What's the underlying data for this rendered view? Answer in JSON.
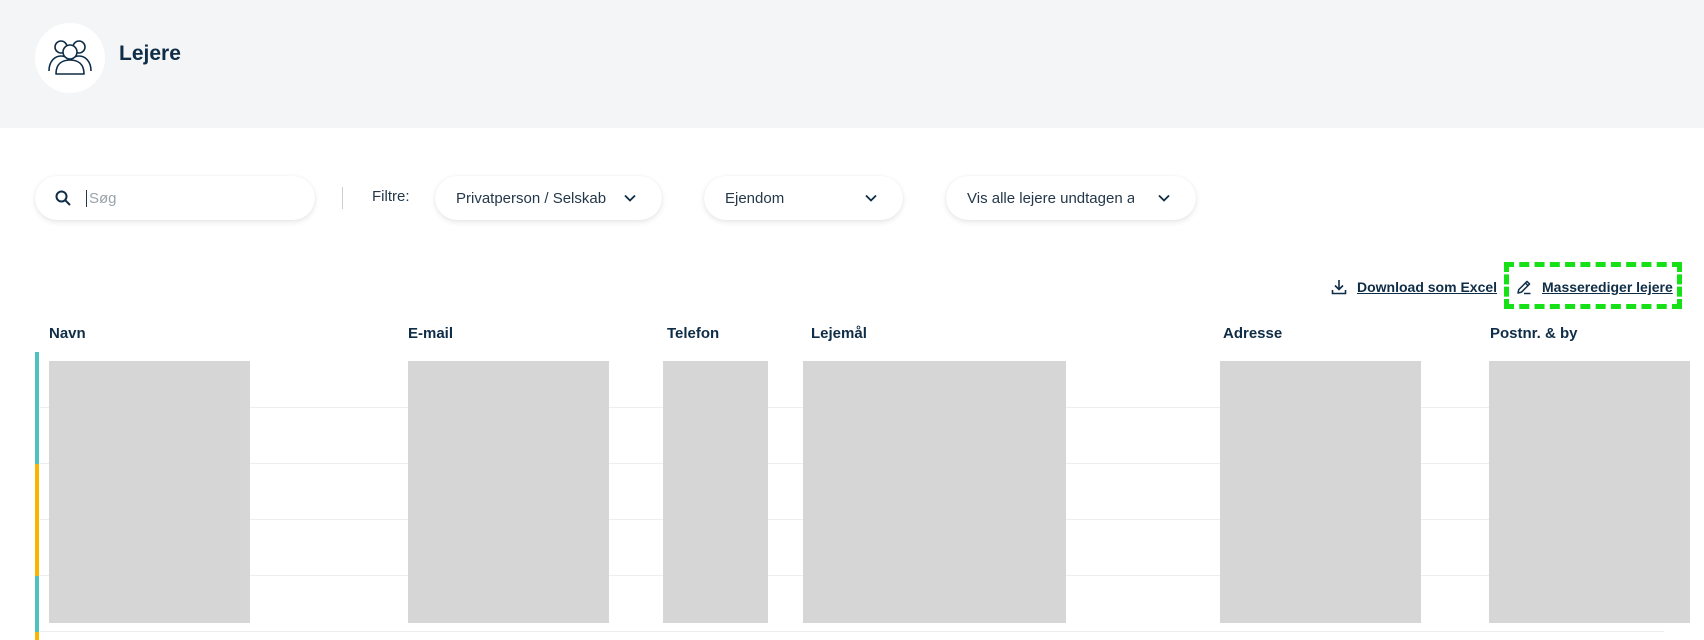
{
  "header": {
    "title": "Lejere",
    "icon": "users-icon"
  },
  "search": {
    "placeholder": "Søg",
    "value": ""
  },
  "filters": {
    "label": "Filtre:",
    "type_select": "Privatperson / Selskab",
    "property_select": "Ejendom",
    "visibility_select": "Vis alle lejere undtagen an"
  },
  "actions": {
    "download_excel": "Download som Excel",
    "mass_edit": "Masserediger lejere"
  },
  "table": {
    "columns": [
      "Navn",
      "E-mail",
      "Telefon",
      "Lejemål",
      "Adresse",
      "Postnr. & by"
    ],
    "row_status_colors": [
      "#4fc1bf",
      "#f7b500",
      "#4fc1bf",
      "#f7b500"
    ]
  },
  "colors": {
    "accent_teal": "#4fc1bf",
    "accent_amber": "#f7b500",
    "text_dark": "#0f2d46",
    "highlight": "#16e016"
  }
}
